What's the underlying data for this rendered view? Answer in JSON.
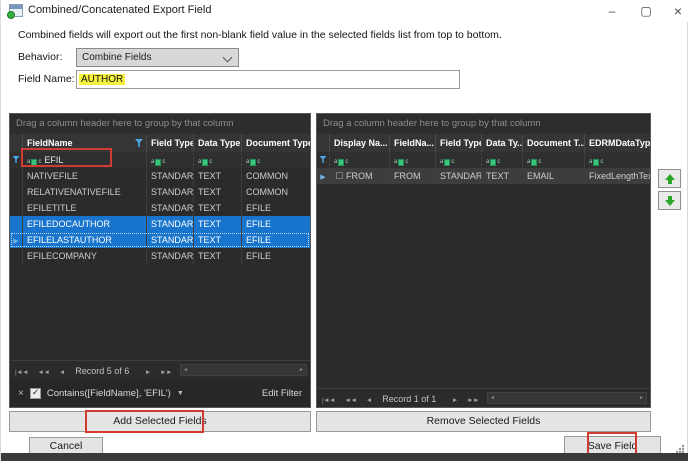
{
  "window": {
    "title": "Combined/Concatenated Export Field",
    "controls": {
      "minimize": "–",
      "maximize": "▢",
      "close": "×"
    }
  },
  "description": "Combined fields will export out the first non-blank field value in the selected fields list from top to bottom.",
  "form": {
    "behavior_label": "Behavior:",
    "behavior_value": "Combine Fields",
    "field_name_label": "Field Name:",
    "field_name_value": "AUTHOR"
  },
  "icons": {
    "row_arrow": "▶"
  },
  "left_grid": {
    "group_hint": "Drag a column header here to group by that column",
    "columns": [
      "FieldName",
      "Field Type",
      "Data Type",
      "Document Type"
    ],
    "filter_row": {
      "field_name_filter": "EFIL"
    },
    "rows": [
      {
        "cells": [
          "NATIVEFILE",
          "STANDARD",
          "TEXT",
          "COMMON"
        ],
        "selected": false
      },
      {
        "cells": [
          "RELATIVENATIVEFILE",
          "STANDARD",
          "TEXT",
          "COMMON"
        ],
        "selected": false
      },
      {
        "cells": [
          "EFILETITLE",
          "STANDARD",
          "TEXT",
          "EFILE"
        ],
        "selected": false
      },
      {
        "cells": [
          "EFILEDOCAUTHOR",
          "STANDARD",
          "TEXT",
          "EFILE"
        ],
        "selected": true
      },
      {
        "cells": [
          "EFILELASTAUTHOR",
          "STANDARD",
          "TEXT",
          "EFILE"
        ],
        "selected": true,
        "focused": true
      },
      {
        "cells": [
          "EFILECOMPANY",
          "STANDARD",
          "TEXT",
          "EFILE"
        ],
        "selected": false
      }
    ],
    "pager": {
      "nav_first": "|◄◄",
      "nav_prev_page": "◄◄",
      "nav_prev": "◄",
      "label": "Record 5 of 6",
      "nav_next": "►",
      "nav_next_page": "►►",
      "nav_last": "►►|",
      "scroll_left": "◄",
      "scroll_right": "►"
    },
    "filter_bar": {
      "remove_glyph": "×",
      "filter_text": "Contains([FieldName], 'EFIL')",
      "dropdown_glyph": "▼",
      "edit_filter_label": "Edit Filter"
    },
    "add_button_label": "Add Selected Fields"
  },
  "right_grid": {
    "group_hint": "Drag a column header here to group by that column",
    "columns": [
      "Display Na...",
      "FieldNa...",
      "Field Type",
      "Data Ty...",
      "Document T...",
      "EDRMDataType"
    ],
    "rows": [
      {
        "cells": [
          "FROM",
          "FROM",
          "STANDARD",
          "TEXT",
          "EMAIL",
          "FixedLengthText ..."
        ],
        "selected": true
      }
    ],
    "pager": {
      "nav_first": "|◄◄",
      "nav_prev_page": "◄◄",
      "nav_prev": "◄",
      "label": "Record 1 of 1",
      "nav_next": "►",
      "nav_next_page": "►►",
      "nav_last": "►►|",
      "scroll_left": "◄",
      "scroll_right": "►"
    },
    "remove_button_label": "Remove Selected Fields"
  },
  "footer": {
    "cancel_label": "Cancel",
    "save_label": "Save Field"
  },
  "colors": {
    "selection": "#1874cc",
    "annotation": "#d23b31",
    "accent_green": "#2aa62a",
    "highlight": "#f6f13c"
  }
}
